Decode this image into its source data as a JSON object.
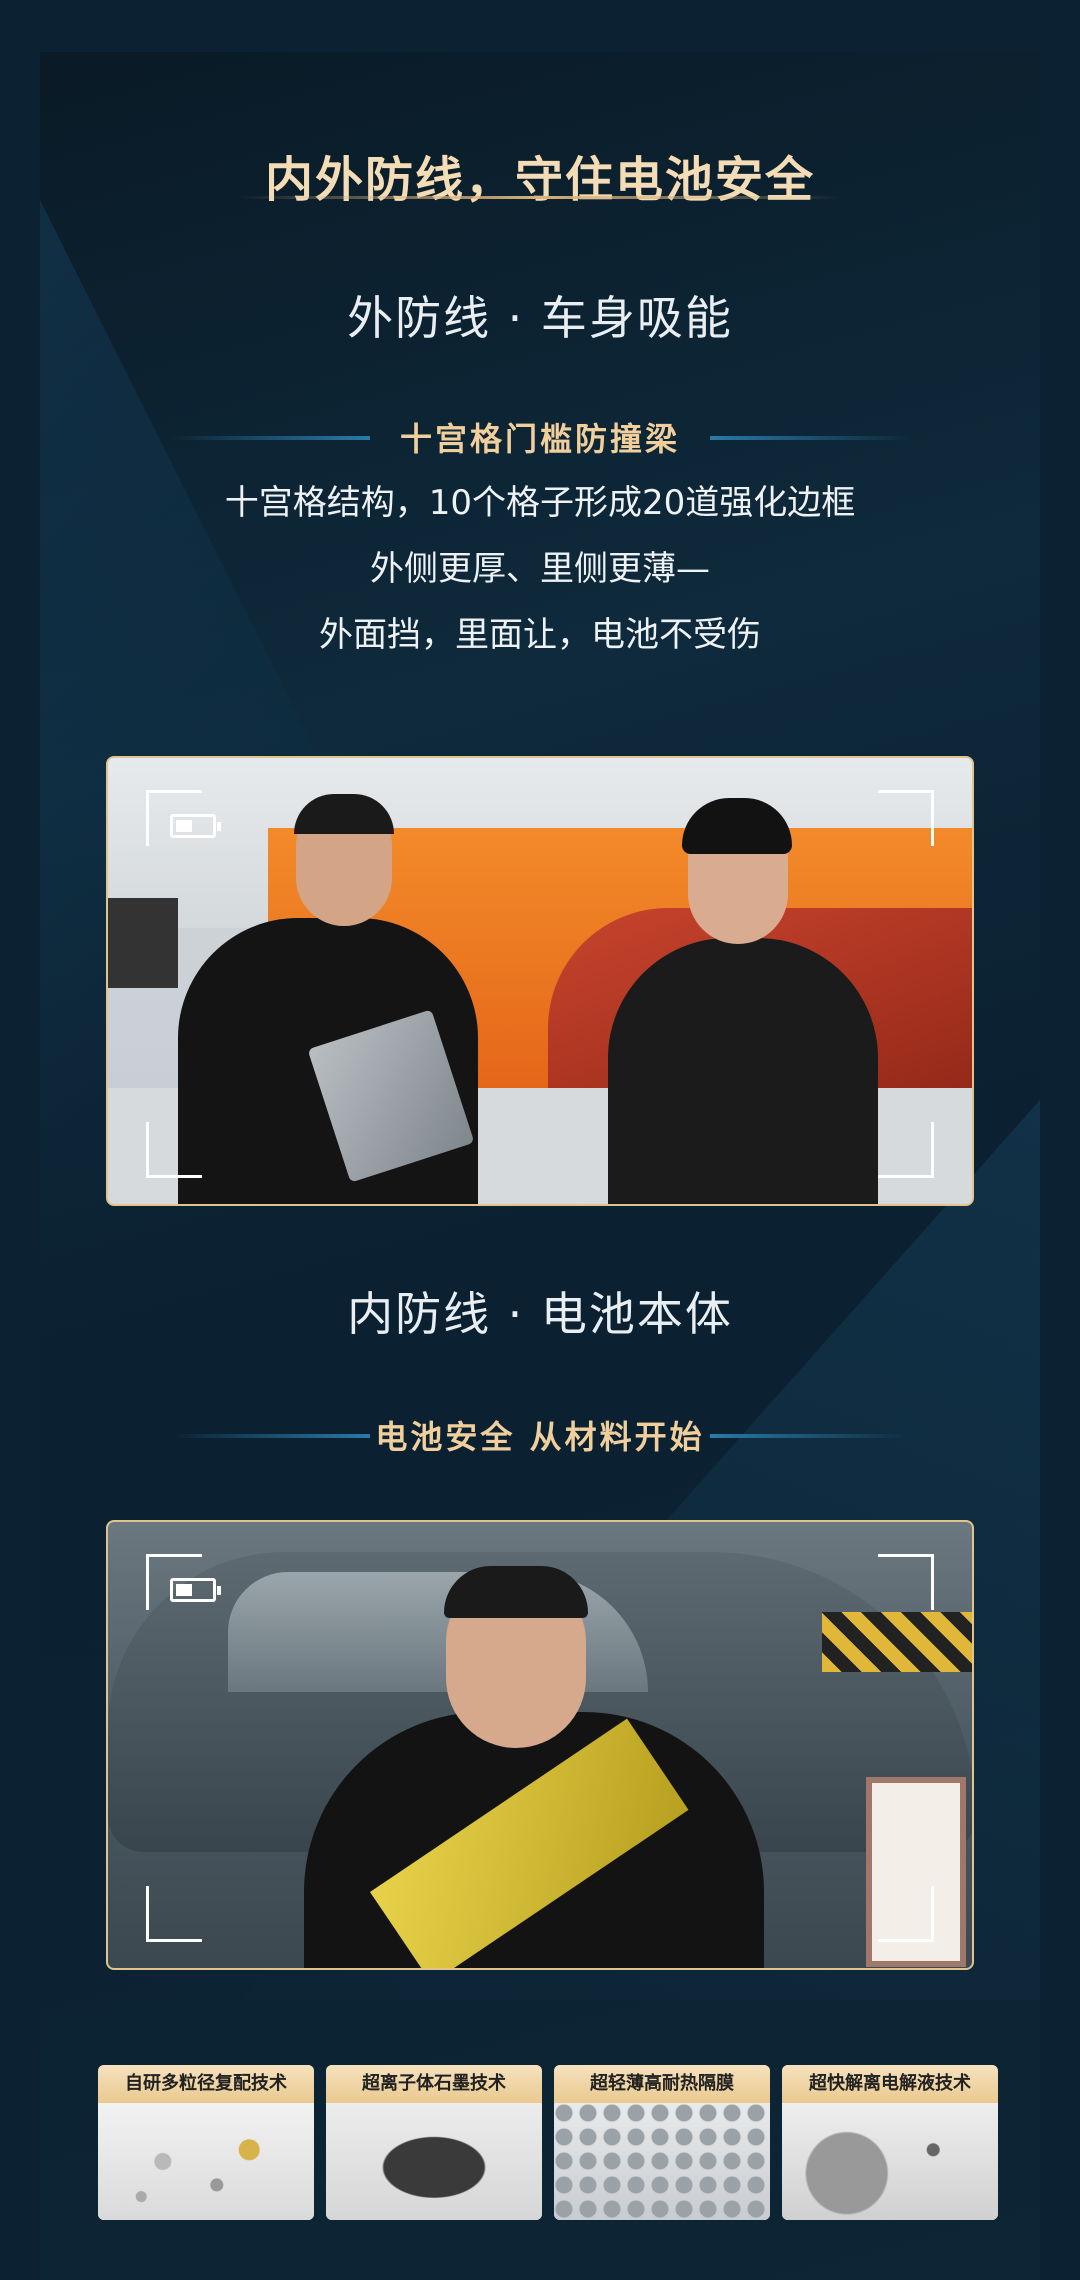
{
  "title": "内外防线，守住电池安全",
  "outer": {
    "heading": "外防线 · 车身吸能",
    "subheading": "十宫格门槛防撞梁",
    "lines": [
      "十宫格结构，10个格子形成20道强化边框",
      "外侧更厚、里侧更薄—",
      "外面挡，里面让，电池不受伤"
    ]
  },
  "inner": {
    "heading": "内防线 · 电池本体",
    "subheading": "电池安全 从材料开始"
  },
  "tech_cards": [
    {
      "label": "自研多粒径复配技术"
    },
    {
      "label": "超离子体石墨技术"
    },
    {
      "label": "超轻薄高耐热隔膜"
    },
    {
      "label": "超快解离电解液技术"
    }
  ],
  "icons": {
    "battery": "battery-icon",
    "viewfinder": "viewfinder-corner-icon"
  },
  "colors": {
    "background": "#0c2232",
    "title": "#f3dcb6",
    "accent": "#f0cf9c",
    "frame": "#e0c48c"
  }
}
